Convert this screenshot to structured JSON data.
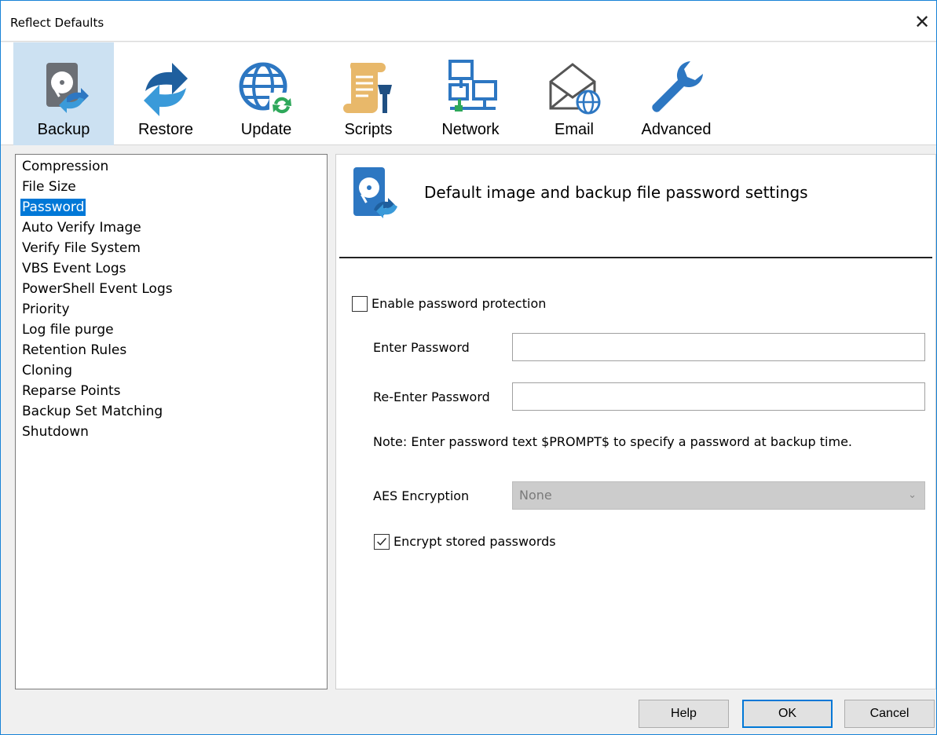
{
  "window": {
    "title": "Reflect Defaults",
    "close_glyph": "✕"
  },
  "toolbar": {
    "items": [
      {
        "label": "Backup",
        "icon": "backup-icon",
        "selected": true
      },
      {
        "label": "Restore",
        "icon": "restore-icon",
        "selected": false
      },
      {
        "label": "Update",
        "icon": "update-icon",
        "selected": false
      },
      {
        "label": "Scripts",
        "icon": "scripts-icon",
        "selected": false
      },
      {
        "label": "Network",
        "icon": "network-icon",
        "selected": false
      },
      {
        "label": "Email",
        "icon": "email-icon",
        "selected": false
      },
      {
        "label": "Advanced",
        "icon": "wrench-icon",
        "selected": false
      }
    ]
  },
  "tree": {
    "items": [
      {
        "label": "Compression"
      },
      {
        "label": "File Size"
      },
      {
        "label": "Password",
        "selected": true
      },
      {
        "label": "Auto Verify Image"
      },
      {
        "label": "Verify File System"
      },
      {
        "label": "VBS Event Logs"
      },
      {
        "label": "PowerShell Event Logs"
      },
      {
        "label": "Priority"
      },
      {
        "label": "Log file purge"
      },
      {
        "label": "Retention Rules"
      },
      {
        "label": "Cloning"
      },
      {
        "label": "Reparse Points"
      },
      {
        "label": "Backup Set Matching"
      },
      {
        "label": "Shutdown"
      }
    ]
  },
  "panel": {
    "heading": "Default image and backup file password settings",
    "enable_password": {
      "label": "Enable password protection",
      "checked": false
    },
    "enter_password": {
      "label": "Enter Password",
      "value": ""
    },
    "reenter_password": {
      "label": "Re-Enter Password",
      "value": ""
    },
    "note": "Note: Enter password text $PROMPT$ to specify a password at backup time.",
    "aes": {
      "label": "AES Encryption",
      "value": "None"
    },
    "encrypt_stored": {
      "label": "Encrypt stored passwords",
      "checked": true
    }
  },
  "buttons": {
    "help": "Help",
    "ok": "OK",
    "cancel": "Cancel"
  },
  "colors": {
    "selection": "#0078d7",
    "toolbar_selected": "#cce1f2",
    "icon_blue": "#2d77c2",
    "icon_gray": "#6b6f75",
    "scripts_tan": "#e8b86a"
  }
}
